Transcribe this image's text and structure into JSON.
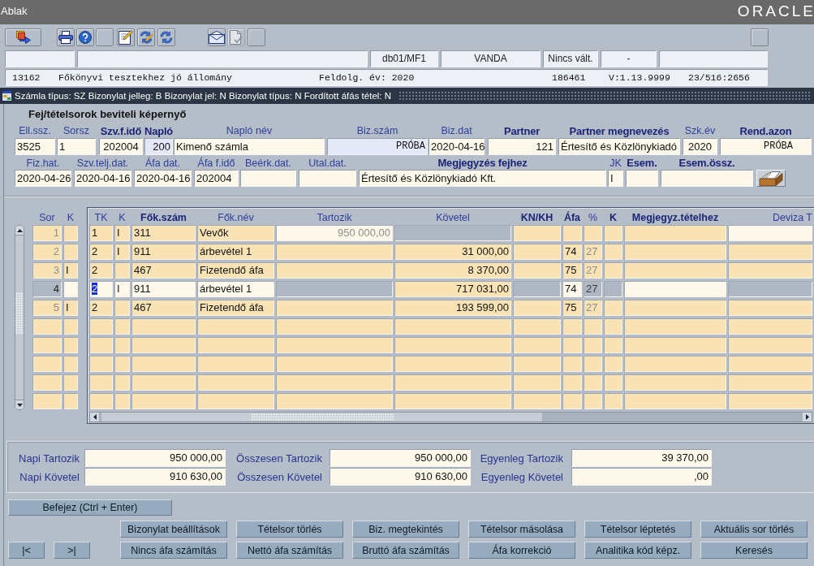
{
  "menu_bar": {
    "menu": "Ablak",
    "logo": "ORACLE"
  },
  "toolbar": [
    {
      "disabled": false
    },
    {
      "disabled": false
    },
    {
      "disabled": false
    },
    {
      "disabled": false
    },
    {
      "disabled": false
    },
    {
      "disabled": false
    },
    {
      "disabled": false
    },
    {
      "disabled": false
    },
    {
      "disabled": true
    },
    {
      "disabled": false
    },
    {
      "disabled": false
    }
  ],
  "status_fields": [
    "db01/MF1",
    "VANDA",
    "Nincs vált.",
    "-"
  ],
  "session_info": [
    "13162",
    "Főkönyvi tesztekhez jó állomány",
    "Feldolg. év: 2020",
    "186461",
    "V:1.13.9999",
    "23/516:2656"
  ],
  "form_window": {
    "title": "Számla típus: SZ Bizonylat jelleg: B Bizonylat jel: N Bizonylat típus: N Fordított áfás tétel: N"
  },
  "header": {
    "title": "Fej/tételsorok beviteli képernyő",
    "rows": [
      {
        "fields": [
          {
            "label": "Ell.ssz.",
            "value": "3525",
            "required": false,
            "readonly": false
          },
          {
            "label": "Sorsz",
            "value": "1",
            "required": false,
            "readonly": false
          },
          {
            "label": "Szv.f.idő",
            "value": "202004",
            "required": true,
            "readonly": false
          },
          {
            "label": "Napló",
            "value": "200",
            "required": true,
            "readonly": true
          },
          {
            "label": "Napló név",
            "value": "Kimenő számla",
            "required": false,
            "readonly": false
          },
          {
            "label": "Biz.szám",
            "value": "PRÓBA",
            "required": false,
            "readonly": true
          },
          {
            "label": "Biz.dat",
            "value": "2020-04-16",
            "required": false,
            "readonly": false
          },
          {
            "label": "Partner",
            "value": "121",
            "required": true,
            "readonly": false
          },
          {
            "label": "Partner megnevezés",
            "value": "Értesítő és Közlönykiadó",
            "required": true,
            "readonly": false
          },
          {
            "label": "Szk.év",
            "value": "2020",
            "required": false,
            "readonly": false
          },
          {
            "label": "Rend.azon",
            "value": "PRÓBA",
            "required": true,
            "readonly": false
          }
        ]
      },
      {
        "fields": [
          {
            "label": "Fiz.hat.",
            "value": "2020-04-26",
            "required": false,
            "readonly": false
          },
          {
            "label": "Szv.telj.dat.",
            "value": "2020-04-16",
            "required": false,
            "readonly": false
          },
          {
            "label": "Áfa dat.",
            "value": "2020-04-16",
            "required": false,
            "readonly": false
          },
          {
            "label": "Áfa f.idő",
            "value": "202004",
            "required": false,
            "readonly": false
          },
          {
            "label": "Beérk.dat.",
            "required": false,
            "readonly": false
          },
          {
            "label": "Utal.dat.",
            "required": false,
            "readonly": false
          },
          {
            "label": "Megjegyzés fejhez",
            "value": "Értesítő és Közlönykiadó Kft.",
            "required": true,
            "readonly": false
          },
          {
            "label": "JK",
            "value": "I",
            "required": false,
            "readonly": false
          },
          {
            "label": "Esem.",
            "required": true,
            "readonly": false
          },
          {
            "label": "Esem.össz.",
            "required": true,
            "readonly": false
          }
        ]
      }
    ]
  },
  "lines": {
    "row_header_columns": [
      "Sor",
      "K"
    ],
    "columns": [
      {
        "label": "TK",
        "required": false
      },
      {
        "label": "K",
        "required": false
      },
      {
        "label": "Fők.szám",
        "required": true
      },
      {
        "label": "Fők.név",
        "required": false
      },
      {
        "label": "Tartozik",
        "required": false
      },
      {
        "label": "Követel",
        "required": false
      },
      {
        "label": "KN/KH",
        "required": true
      },
      {
        "label": "Áfa",
        "required": true
      },
      {
        "label": "%",
        "required": false
      },
      {
        "label": "K",
        "required": true
      },
      {
        "label": "Megjegyz.tételhez",
        "required": true
      },
      {
        "label": "Deviza T",
        "required": false
      }
    ],
    "rows": [
      {
        "sor": "1",
        "selected": false,
        "cells": [
          {
            "text": "1",
            "kind": "normal"
          },
          {
            "text": "I",
            "kind": "normal"
          },
          {
            "text": "311",
            "kind": "normal"
          },
          {
            "text": "Vevők",
            "kind": "normal"
          },
          {
            "text": "950 000,00",
            "kind": "readonly"
          },
          {
            "kind": "disabled"
          },
          {
            "kind": "normal"
          },
          {
            "kind": "normal"
          },
          {
            "kind": "normal"
          },
          {
            "kind": "normal"
          },
          {
            "kind": "normal"
          },
          {
            "kind": "current"
          }
        ]
      },
      {
        "sor": "2",
        "selected": false,
        "cells": [
          {
            "text": "2",
            "kind": "normal"
          },
          {
            "text": "I",
            "kind": "normal"
          },
          {
            "text": "911",
            "kind": "normal"
          },
          {
            "text": "árbevétel 1",
            "kind": "normal"
          },
          {
            "kind": "normal"
          },
          {
            "text": "31 000,00",
            "kind": "normal"
          },
          {
            "kind": "normal"
          },
          {
            "text": "74",
            "kind": "normal"
          },
          {
            "text": "27",
            "kind": "dim"
          },
          {
            "kind": "normal"
          },
          {
            "kind": "normal"
          },
          {
            "kind": "normal"
          }
        ]
      },
      {
        "sor": "3",
        "k": "I",
        "selected": false,
        "cells": [
          {
            "text": "2",
            "kind": "normal"
          },
          {
            "kind": "normal"
          },
          {
            "text": "467",
            "kind": "normal"
          },
          {
            "text": "Fizetendő áfa",
            "kind": "normal"
          },
          {
            "kind": "normal"
          },
          {
            "text": "8 370,00",
            "kind": "normal"
          },
          {
            "kind": "normal"
          },
          {
            "text": "75",
            "kind": "normal"
          },
          {
            "text": "27",
            "kind": "dim"
          },
          {
            "kind": "normal"
          },
          {
            "kind": "normal"
          },
          {
            "kind": "normal"
          }
        ]
      },
      {
        "sor": "4",
        "selected": true,
        "cells": [
          {
            "text": "2",
            "kind": "focused"
          },
          {
            "text": "I",
            "kind": "current"
          },
          {
            "text": "911",
            "kind": "current"
          },
          {
            "text": "árbevétel 1",
            "kind": "current"
          },
          {
            "kind": "disabled"
          },
          {
            "text": "717 031,00",
            "kind": "normal"
          },
          {
            "kind": "disabled"
          },
          {
            "text": "74",
            "kind": "current"
          },
          {
            "text": "27",
            "kind": "disabled"
          },
          {
            "kind": "disabled"
          },
          {
            "kind": "current"
          },
          {
            "kind": "disabled"
          }
        ]
      },
      {
        "sor": "5",
        "k": "I",
        "selected": false,
        "cells": [
          {
            "text": "2",
            "kind": "normal"
          },
          {
            "kind": "normal"
          },
          {
            "text": "467",
            "kind": "normal"
          },
          {
            "text": "Fizetendő áfa",
            "kind": "normal"
          },
          {
            "kind": "normal"
          },
          {
            "text": "193 599,00",
            "kind": "normal"
          },
          {
            "kind": "normal"
          },
          {
            "text": "75",
            "kind": "normal"
          },
          {
            "text": "27",
            "kind": "dim"
          },
          {
            "kind": "normal"
          },
          {
            "kind": "normal"
          },
          {
            "kind": "normal"
          }
        ]
      },
      {
        "selected": false
      },
      {
        "selected": false
      },
      {
        "selected": false
      },
      {
        "selected": false
      },
      {
        "selected": false
      }
    ]
  },
  "totals": {
    "rows": [
      {
        "fields": [
          {
            "label": "Napi Tartozik",
            "value": "950 000,00"
          },
          {
            "label": "Összesen Tartozik",
            "value": "950 000,00"
          },
          {
            "label": "Egyenleg Tartozik",
            "value": "39 370,00"
          }
        ]
      },
      {
        "fields": [
          {
            "label": "Napi Követel",
            "value": "910 630,00"
          },
          {
            "label": "Összesen Követel",
            "value": "910 630,00"
          },
          {
            "label": "Egyenleg Követel",
            "value": ",00"
          }
        ]
      }
    ]
  },
  "finish_button": "Befejez (Ctrl + Enter)",
  "nav_buttons": [
    "|<",
    ">|"
  ],
  "action_rows": [
    {
      "buttons": [
        "Bizonylat beállítások",
        "Tételsor törlés",
        "Biz. megtekintés",
        "Tételsor másolása",
        "Tételsor léptetés",
        "Aktuális sor törlés"
      ]
    },
    {
      "buttons": [
        "Nincs áfa számítás",
        "Nettó áfa számítás",
        "Bruttó áfa számítás",
        "Áfa korrekció",
        "Analitika kód képz.",
        "Keresés"
      ]
    }
  ]
}
